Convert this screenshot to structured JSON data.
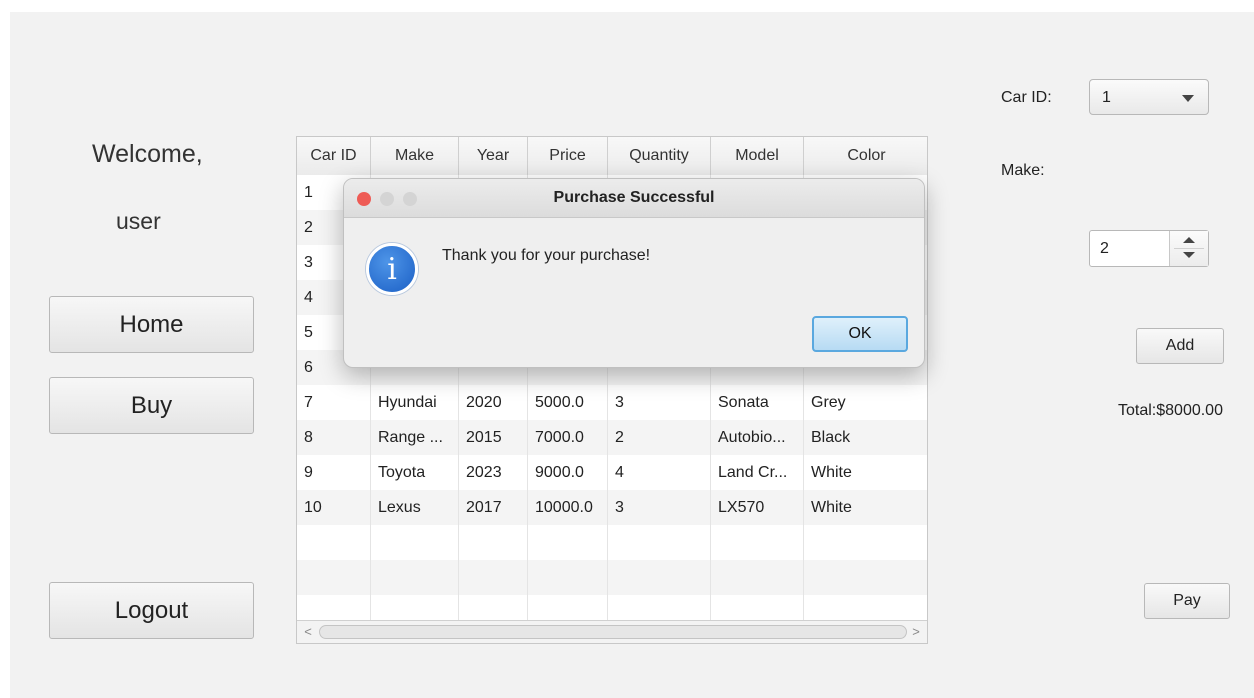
{
  "sidebar": {
    "welcome": "Welcome,",
    "user": "user",
    "home_label": "Home",
    "buy_label": "Buy",
    "logout_label": "Logout"
  },
  "table": {
    "columns": [
      "Car ID",
      "Make",
      "Year",
      "Price",
      "Quantity",
      "Model",
      "Color"
    ],
    "rows": [
      [
        "1",
        "",
        "",
        "",
        "",
        "",
        ""
      ],
      [
        "2",
        "",
        "",
        "",
        "",
        "",
        ""
      ],
      [
        "3",
        "",
        "",
        "",
        "",
        "",
        ""
      ],
      [
        "4",
        "",
        "",
        "",
        "",
        "",
        ""
      ],
      [
        "5",
        "",
        "",
        "",
        "",
        "",
        ""
      ],
      [
        "6",
        "",
        "",
        "",
        "",
        "",
        ""
      ],
      [
        "7",
        "Hyundai",
        "2020",
        "5000.0",
        "3",
        "Sonata",
        "Grey"
      ],
      [
        "8",
        "Range ...",
        "2015",
        "7000.0",
        "2",
        "Autobio...",
        "Black"
      ],
      [
        "9",
        "Toyota",
        "2023",
        "9000.0",
        "4",
        "Land Cr...",
        "White"
      ],
      [
        "10",
        "Lexus",
        "2017",
        "10000.0",
        "3",
        "LX570",
        "White"
      ]
    ],
    "scroll_left": "<",
    "scroll_right": ">"
  },
  "form": {
    "car_id_label": "Car ID:",
    "car_id_value": "1",
    "make_label": "Make:",
    "quantity_value": "2",
    "add_label": "Add",
    "total_text": "Total:$8000.00",
    "pay_label": "Pay"
  },
  "dialog": {
    "title": "Purchase Successful",
    "message": "Thank you for your purchase!",
    "ok_label": "OK",
    "icon": "info-icon",
    "icon_glyph": "i",
    "colors": {
      "close": "#ee5b55",
      "inactive": "#d4d4d4",
      "accent": "#5aa8df"
    }
  }
}
